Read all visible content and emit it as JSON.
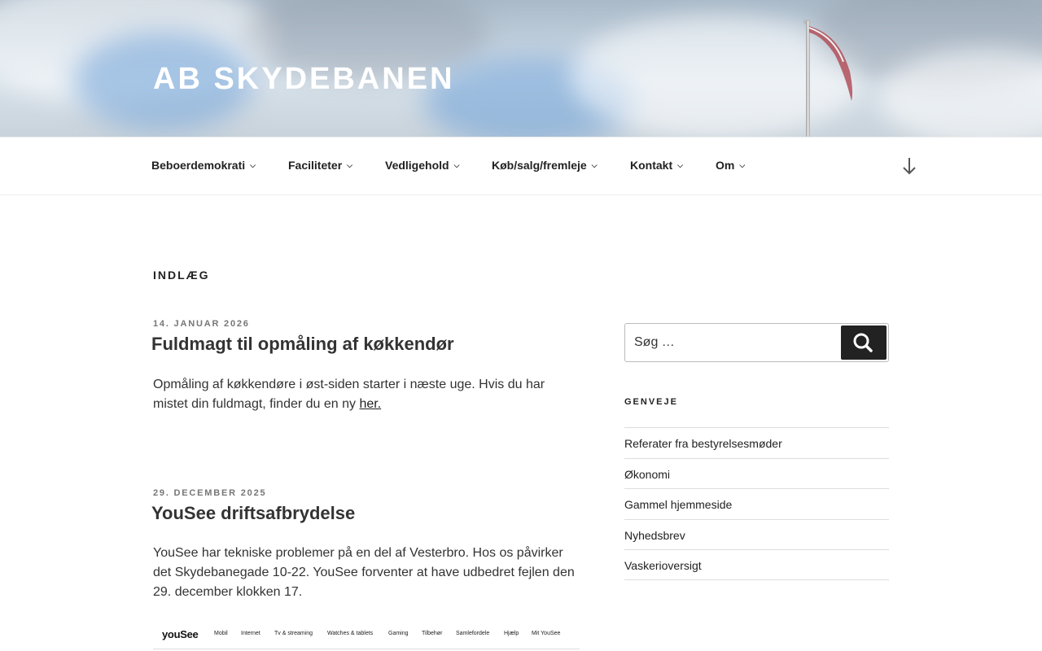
{
  "site": {
    "title": "AB Skydebanen"
  },
  "nav": {
    "items": [
      {
        "label": "Beboerdemokrati"
      },
      {
        "label": "Faciliteter"
      },
      {
        "label": "Vedligehold"
      },
      {
        "label": "Køb/salg/fremleje"
      },
      {
        "label": "Kontakt"
      },
      {
        "label": "Om"
      }
    ],
    "scroll_icon": "arrow-down-icon"
  },
  "main": {
    "heading": "Indlæg",
    "posts": [
      {
        "date": "14. januar 2026",
        "title": "Fuldmagt til opmåling af køkkendør",
        "body_text": "Opmåling af køkkendøre i øst-siden starter i næste uge. Hvis du har mistet din fuldmagt, finder du en ny",
        "link_text": "her."
      },
      {
        "date": "29. december 2025",
        "title": "YouSee driftsafbrydelse",
        "body_text": "YouSee har tekniske problemer på en del af Vesterbro. Hos os påvirker det Skydebanegade 10-22. YouSee forventer at have udbedret fejlen den 29. december klokken 17."
      }
    ],
    "yousee_screenshot": {
      "logo": "youSee",
      "items": [
        "Mobil",
        "Internet",
        "Tv & streaming",
        "Watches & tablets",
        "Gaming",
        "Tilbehør",
        "Samlefordele",
        "Hjælp",
        "Mit YouSee"
      ]
    }
  },
  "sidebar": {
    "search": {
      "placeholder": "Søg …",
      "button_icon": "search-icon"
    },
    "widget_title": "Genveje",
    "links": [
      {
        "label": "Referater fra bestyrelsesmøder"
      },
      {
        "label": "Økonomi"
      },
      {
        "label": "Gammel hjemmeside"
      },
      {
        "label": "Nyhedsbrev"
      },
      {
        "label": "Vaskerioversigt"
      }
    ]
  }
}
